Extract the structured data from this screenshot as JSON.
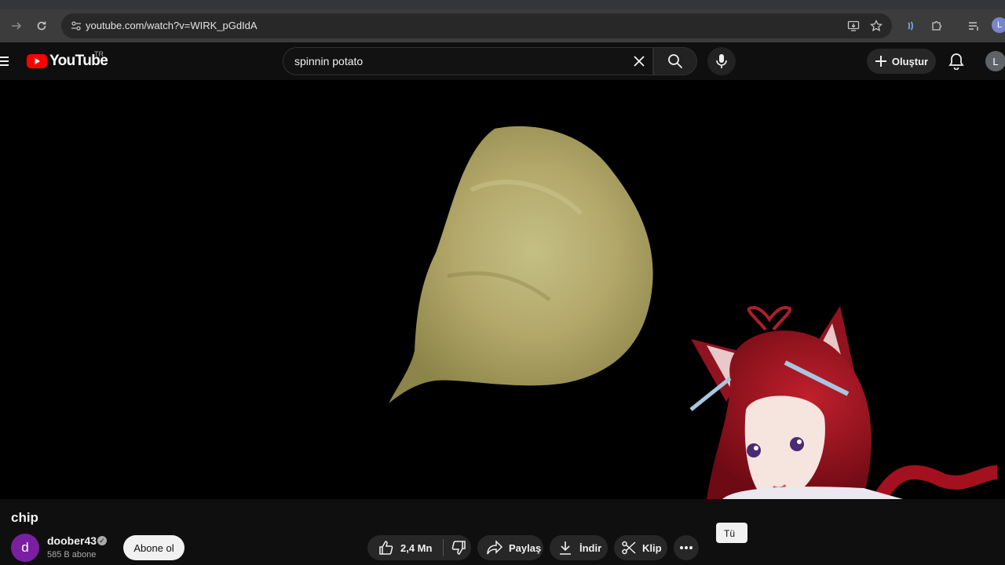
{
  "browser": {
    "url": "youtube.com/watch?v=WIRK_pGdIdA",
    "profile_initial": "L",
    "icons": [
      "forward-icon",
      "reload-icon",
      "site-info-icon",
      "install-icon",
      "star-icon",
      "extension-icon",
      "puzzle-icon",
      "media-icon"
    ]
  },
  "header": {
    "logo_text": "YouTube",
    "country": "TR",
    "search_query": "spinnin potato",
    "create_label": "Oluştur",
    "user_initial": "L"
  },
  "video": {
    "title": "chip"
  },
  "channel": {
    "avatar_initial": "d",
    "name": "doober43",
    "subscribers": "585 B abone",
    "subscribe_label": "Abone ol"
  },
  "actions": {
    "like_count": "2,4 Mn",
    "share_label": "Paylaş",
    "download_label": "İndir",
    "clip_label": "Klip",
    "tooltip_text": "Tü"
  },
  "colors": {
    "background": "#0f0f0f",
    "brand_red": "#ff0000",
    "chip": "#c9c081"
  }
}
